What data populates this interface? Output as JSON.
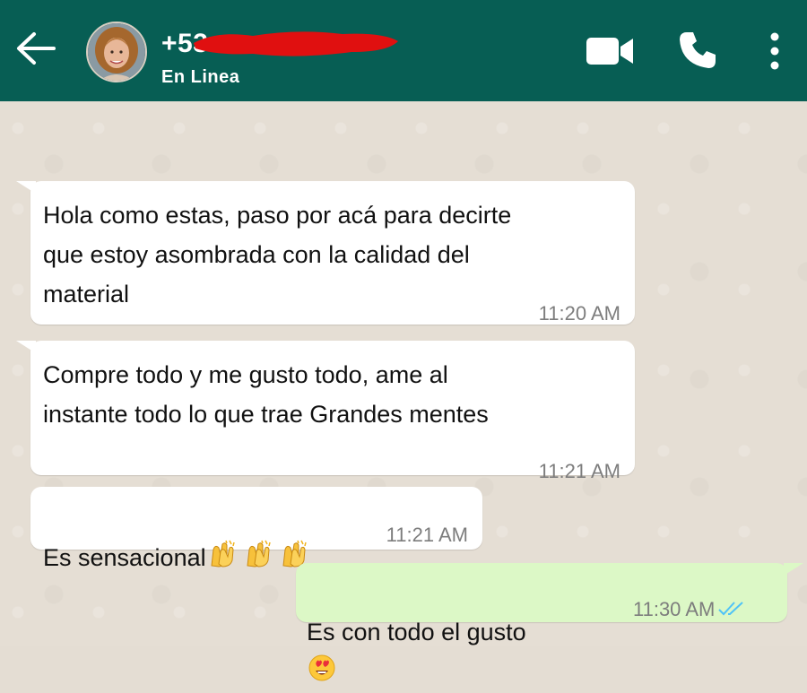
{
  "header": {
    "contact_name": "+53",
    "status": "En Linea",
    "icons": [
      "back-arrow-icon",
      "avatar",
      "video-call-icon",
      "phone-icon",
      "more-vert-icon"
    ]
  },
  "messages": [
    {
      "direction": "incoming",
      "text": "Hola como estas, paso por acá para decirte\nque estoy asombrada con la calidad del\nmaterial",
      "time": "11:20 AM"
    },
    {
      "direction": "incoming",
      "text": "Compre todo y me gusto todo, ame al\ninstante todo lo que trae Grandes mentes",
      "time": "11:21 AM"
    },
    {
      "direction": "incoming",
      "text": "Es sensacional",
      "emoji": "clapping-hands x3",
      "time": "11:21 AM"
    },
    {
      "direction": "outgoing",
      "text": "Es con todo el gusto",
      "emoji": "heart-eyes",
      "time": "11:30 AM",
      "read": true
    }
  ],
  "colors": {
    "header": "#075e54",
    "incoming_bubble": "#ffffff",
    "outgoing_bubble": "#dcf8c6",
    "chat_background": "#e5ded4",
    "read_ticks": "#4fc3f7",
    "redaction": "#e01010"
  }
}
